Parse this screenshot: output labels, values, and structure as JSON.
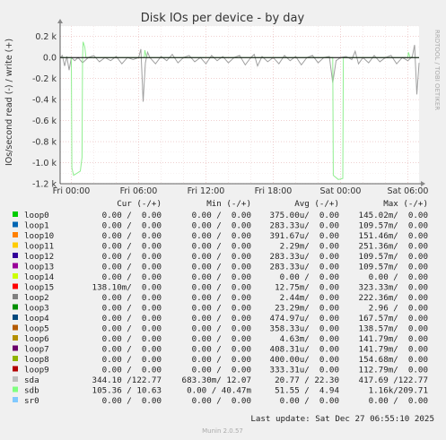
{
  "chart_data": {
    "type": "line",
    "title": "Disk IOs per device - by day",
    "ylabel": "IOs/second read (-) / write (+)",
    "side_label": "RRDTOOL / TOBI OETIKER",
    "ylim": [
      -1.2,
      0.3
    ],
    "y_ticks": [
      {
        "value": 0.2,
        "label": "0.2 k"
      },
      {
        "value": 0.0,
        "label": "0.0"
      },
      {
        "value": -0.2,
        "label": "-0.2 k"
      },
      {
        "value": -0.4,
        "label": "-0.4 k"
      },
      {
        "value": -0.6,
        "label": "-0.6 k"
      },
      {
        "value": -0.8,
        "label": "-0.8 k"
      },
      {
        "value": -1.0,
        "label": "-1.0 k"
      },
      {
        "value": -1.2,
        "label": "-1.2 k"
      }
    ],
    "x_range_hours": [
      -1.0,
      31.0
    ],
    "x_ticks": [
      {
        "hour": 0,
        "label": "Fri 00:00"
      },
      {
        "hour": 6,
        "label": "Fri 06:00"
      },
      {
        "hour": 12,
        "label": "Fri 12:00"
      },
      {
        "hour": 18,
        "label": "Fri 18:00"
      },
      {
        "hour": 24,
        "label": "Sat 00:00"
      },
      {
        "hour": 30,
        "label": "Sat 06:00"
      }
    ],
    "series": [
      {
        "name": "sda",
        "color": "#a0a0a0",
        "points": [
          [
            -1.0,
            0.0
          ],
          [
            -0.8,
            0.02
          ],
          [
            -0.6,
            -0.08
          ],
          [
            -0.4,
            0.01
          ],
          [
            -0.2,
            -0.12
          ],
          [
            0.0,
            0.0
          ],
          [
            0.3,
            -0.03
          ],
          [
            0.6,
            0.0
          ],
          [
            1.0,
            -0.05
          ],
          [
            1.5,
            0.0
          ],
          [
            2.0,
            0.02
          ],
          [
            2.5,
            -0.04
          ],
          [
            3.0,
            0.0
          ],
          [
            3.5,
            -0.03
          ],
          [
            4.0,
            0.01
          ],
          [
            4.5,
            -0.06
          ],
          [
            5.0,
            0.0
          ],
          [
            5.5,
            -0.02
          ],
          [
            6.0,
            0.0
          ],
          [
            6.2,
            0.08
          ],
          [
            6.4,
            -0.42
          ],
          [
            6.6,
            -0.05
          ],
          [
            6.8,
            0.05
          ],
          [
            7.0,
            0.0
          ],
          [
            7.5,
            -0.06
          ],
          [
            8.0,
            0.01
          ],
          [
            8.5,
            -0.03
          ],
          [
            9.0,
            0.03
          ],
          [
            9.5,
            -0.05
          ],
          [
            10.0,
            0.0
          ],
          [
            10.5,
            0.02
          ],
          [
            11.0,
            -0.04
          ],
          [
            11.5,
            0.0
          ],
          [
            12.0,
            -0.06
          ],
          [
            12.5,
            0.02
          ],
          [
            13.0,
            -0.03
          ],
          [
            13.5,
            0.01
          ],
          [
            14.0,
            -0.05
          ],
          [
            14.5,
            0.0
          ],
          [
            15.0,
            0.02
          ],
          [
            15.5,
            -0.07
          ],
          [
            16.0,
            0.0
          ],
          [
            16.3,
            0.03
          ],
          [
            16.6,
            -0.08
          ],
          [
            17.0,
            0.01
          ],
          [
            17.5,
            -0.04
          ],
          [
            18.0,
            0.0
          ],
          [
            18.5,
            -0.06
          ],
          [
            19.0,
            0.02
          ],
          [
            19.5,
            -0.03
          ],
          [
            20.0,
            0.01
          ],
          [
            20.5,
            -0.07
          ],
          [
            21.0,
            0.0
          ],
          [
            21.5,
            0.02
          ],
          [
            22.0,
            -0.05
          ],
          [
            22.5,
            0.0
          ],
          [
            23.0,
            0.01
          ],
          [
            23.3,
            -0.24
          ],
          [
            23.6,
            -0.03
          ],
          [
            24.0,
            0.0
          ],
          [
            24.5,
            0.01
          ],
          [
            25.0,
            -0.02
          ],
          [
            25.3,
            0.06
          ],
          [
            25.6,
            -0.06
          ],
          [
            26.0,
            0.0
          ],
          [
            26.5,
            -0.05
          ],
          [
            27.0,
            0.02
          ],
          [
            27.5,
            -0.04
          ],
          [
            28.0,
            0.0
          ],
          [
            28.5,
            0.02
          ],
          [
            29.0,
            -0.06
          ],
          [
            29.5,
            0.0
          ],
          [
            30.0,
            -0.03
          ],
          [
            30.4,
            0.01
          ],
          [
            30.6,
            0.12
          ],
          [
            30.8,
            -0.35
          ],
          [
            31.0,
            -0.05
          ]
        ]
      },
      {
        "name": "sdb",
        "color": "#90ee90",
        "points": [
          [
            -1.0,
            0.0
          ],
          [
            0.0,
            0.0
          ],
          [
            0.05,
            -1.05
          ],
          [
            0.2,
            -1.12
          ],
          [
            0.5,
            -1.1
          ],
          [
            0.8,
            -1.08
          ],
          [
            0.95,
            -0.95
          ],
          [
            1.0,
            0.0
          ],
          [
            1.05,
            0.15
          ],
          [
            1.2,
            0.1
          ],
          [
            1.3,
            0.0
          ],
          [
            6.5,
            0.0
          ],
          [
            6.55,
            0.07
          ],
          [
            6.7,
            0.0
          ],
          [
            23.3,
            0.0
          ],
          [
            23.35,
            -1.12
          ],
          [
            23.8,
            -1.16
          ],
          [
            24.2,
            -1.15
          ],
          [
            24.25,
            0.0
          ],
          [
            30.0,
            0.0
          ],
          [
            30.05,
            0.05
          ],
          [
            30.2,
            0.0
          ],
          [
            31.0,
            0.0
          ]
        ]
      }
    ],
    "legend_header": {
      "cur": "Cur (-/+)",
      "min": "Min (-/+)",
      "avg": "Avg (-/+)",
      "max": "Max (-/+)"
    },
    "legend": [
      {
        "name": "loop0",
        "color": "#00cc00",
        "cur": "0.00 /  0.00",
        "min": "0.00 /  0.00",
        "avg": "375.00u/  0.00",
        "max": "145.02m/  0.00"
      },
      {
        "name": "loop1",
        "color": "#0066b3",
        "cur": "0.00 /  0.00",
        "min": "0.00 /  0.00",
        "avg": "283.33u/  0.00",
        "max": "109.57m/  0.00"
      },
      {
        "name": "loop10",
        "color": "#ff8000",
        "cur": "0.00 /  0.00",
        "min": "0.00 /  0.00",
        "avg": "391.67u/  0.00",
        "max": "151.46m/  0.00"
      },
      {
        "name": "loop11",
        "color": "#ffcc00",
        "cur": "0.00 /  0.00",
        "min": "0.00 /  0.00",
        "avg": "2.29m/  0.00",
        "max": "251.36m/  0.00"
      },
      {
        "name": "loop12",
        "color": "#330099",
        "cur": "0.00 /  0.00",
        "min": "0.00 /  0.00",
        "avg": "283.33u/  0.00",
        "max": "109.57m/  0.00"
      },
      {
        "name": "loop13",
        "color": "#990099",
        "cur": "0.00 /  0.00",
        "min": "0.00 /  0.00",
        "avg": "283.33u/  0.00",
        "max": "109.57m/  0.00"
      },
      {
        "name": "loop14",
        "color": "#ccff00",
        "cur": "0.00 /  0.00",
        "min": "0.00 /  0.00",
        "avg": "0.00 /  0.00",
        "max": "0.00 /  0.00"
      },
      {
        "name": "loop15",
        "color": "#ff0000",
        "cur": "138.10m/  0.00",
        "min": "0.00 /  0.00",
        "avg": "12.75m/  0.00",
        "max": "323.33m/  0.00"
      },
      {
        "name": "loop2",
        "color": "#808080",
        "cur": "0.00 /  0.00",
        "min": "0.00 /  0.00",
        "avg": "2.44m/  0.00",
        "max": "222.36m/  0.00"
      },
      {
        "name": "loop3",
        "color": "#008f00",
        "cur": "0.00 /  0.00",
        "min": "0.00 /  0.00",
        "avg": "23.29m/  0.00",
        "max": "2.96 /  0.00"
      },
      {
        "name": "loop4",
        "color": "#00487d",
        "cur": "0.00 /  0.00",
        "min": "0.00 /  0.00",
        "avg": "474.97u/  0.00",
        "max": "167.57m/  0.00"
      },
      {
        "name": "loop5",
        "color": "#b35a00",
        "cur": "0.00 /  0.00",
        "min": "0.00 /  0.00",
        "avg": "358.33u/  0.00",
        "max": "138.57m/  0.00"
      },
      {
        "name": "loop6",
        "color": "#b38f00",
        "cur": "0.00 /  0.00",
        "min": "0.00 /  0.00",
        "avg": "4.63m/  0.00",
        "max": "141.79m/  0.00"
      },
      {
        "name": "loop7",
        "color": "#6b006b",
        "cur": "0.00 /  0.00",
        "min": "0.00 /  0.00",
        "avg": "408.31u/  0.00",
        "max": "141.79m/  0.00"
      },
      {
        "name": "loop8",
        "color": "#8fb300",
        "cur": "0.00 /  0.00",
        "min": "0.00 /  0.00",
        "avg": "400.00u/  0.00",
        "max": "154.68m/  0.00"
      },
      {
        "name": "loop9",
        "color": "#b30000",
        "cur": "0.00 /  0.00",
        "min": "0.00 /  0.00",
        "avg": "333.31u/  0.00",
        "max": "112.79m/  0.00"
      },
      {
        "name": "sda",
        "color": "#bebebe",
        "cur": "344.10 /122.77",
        "min": "683.30m/ 12.07",
        "avg": "20.77 / 22.30",
        "max": "417.69 /122.77"
      },
      {
        "name": "sdb",
        "color": "#80ff80",
        "cur": "105.36 / 10.63",
        "min": "0.00 / 40.47m",
        "avg": "51.55 /  4.94",
        "max": "1.16k/209.71"
      },
      {
        "name": "sr0",
        "color": "#80c9ff",
        "cur": "0.00 /  0.00",
        "min": "0.00 /  0.00",
        "avg": "0.00 /  0.00",
        "max": "0.00 /  0.00"
      }
    ],
    "last_update": "Last update: Sat Dec 27 06:55:10 2025",
    "footer": "Munin 2.0.57"
  }
}
